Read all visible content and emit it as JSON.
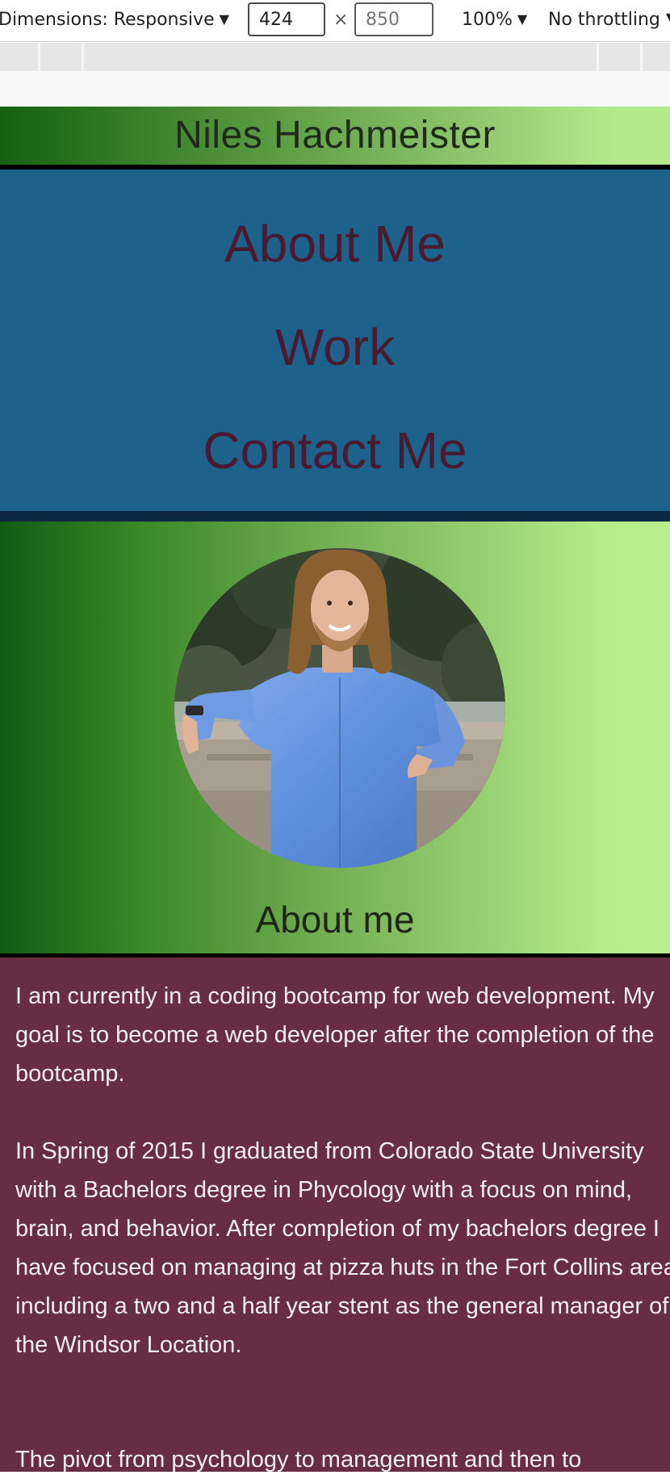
{
  "devtools": {
    "dimensions_label": "Dimensions: Responsive",
    "dimensions_arrow": "▼",
    "width_value": "424",
    "height_placeholder": "850",
    "times": "×",
    "zoom_label": "100%",
    "zoom_arrow": "▼",
    "throttle_label": "No throttling ▼"
  },
  "header": {
    "name": "Niles Hachmeister"
  },
  "nav": {
    "items": [
      {
        "label": "About Me"
      },
      {
        "label": "Work"
      },
      {
        "label": "Contact Me"
      }
    ]
  },
  "hero": {
    "heading": "About me"
  },
  "about": {
    "paragraphs": [
      "I am currently in a coding bootcamp for web development. My goal is to become a web developer after the completion of the bootcamp.",
      "In Spring of 2015 I graduated from Colorado State University with a Bachelors degree in Phycology with a focus on mind, brain, and behavior. After completion of my bachelors degree I have focused on managing at pizza huts in the Fort Collins area, including a two and a half year stent as the general manager of the Windsor Location.",
      "The pivot from psychology to management and then to"
    ]
  },
  "colors": {
    "nav_bg": "#1c628a",
    "nav_text": "#4a1a30",
    "about_bg": "#672d43",
    "about_text": "#f4eef1",
    "gradient_dark": "#115c10",
    "gradient_light": "#b8ef8c"
  }
}
